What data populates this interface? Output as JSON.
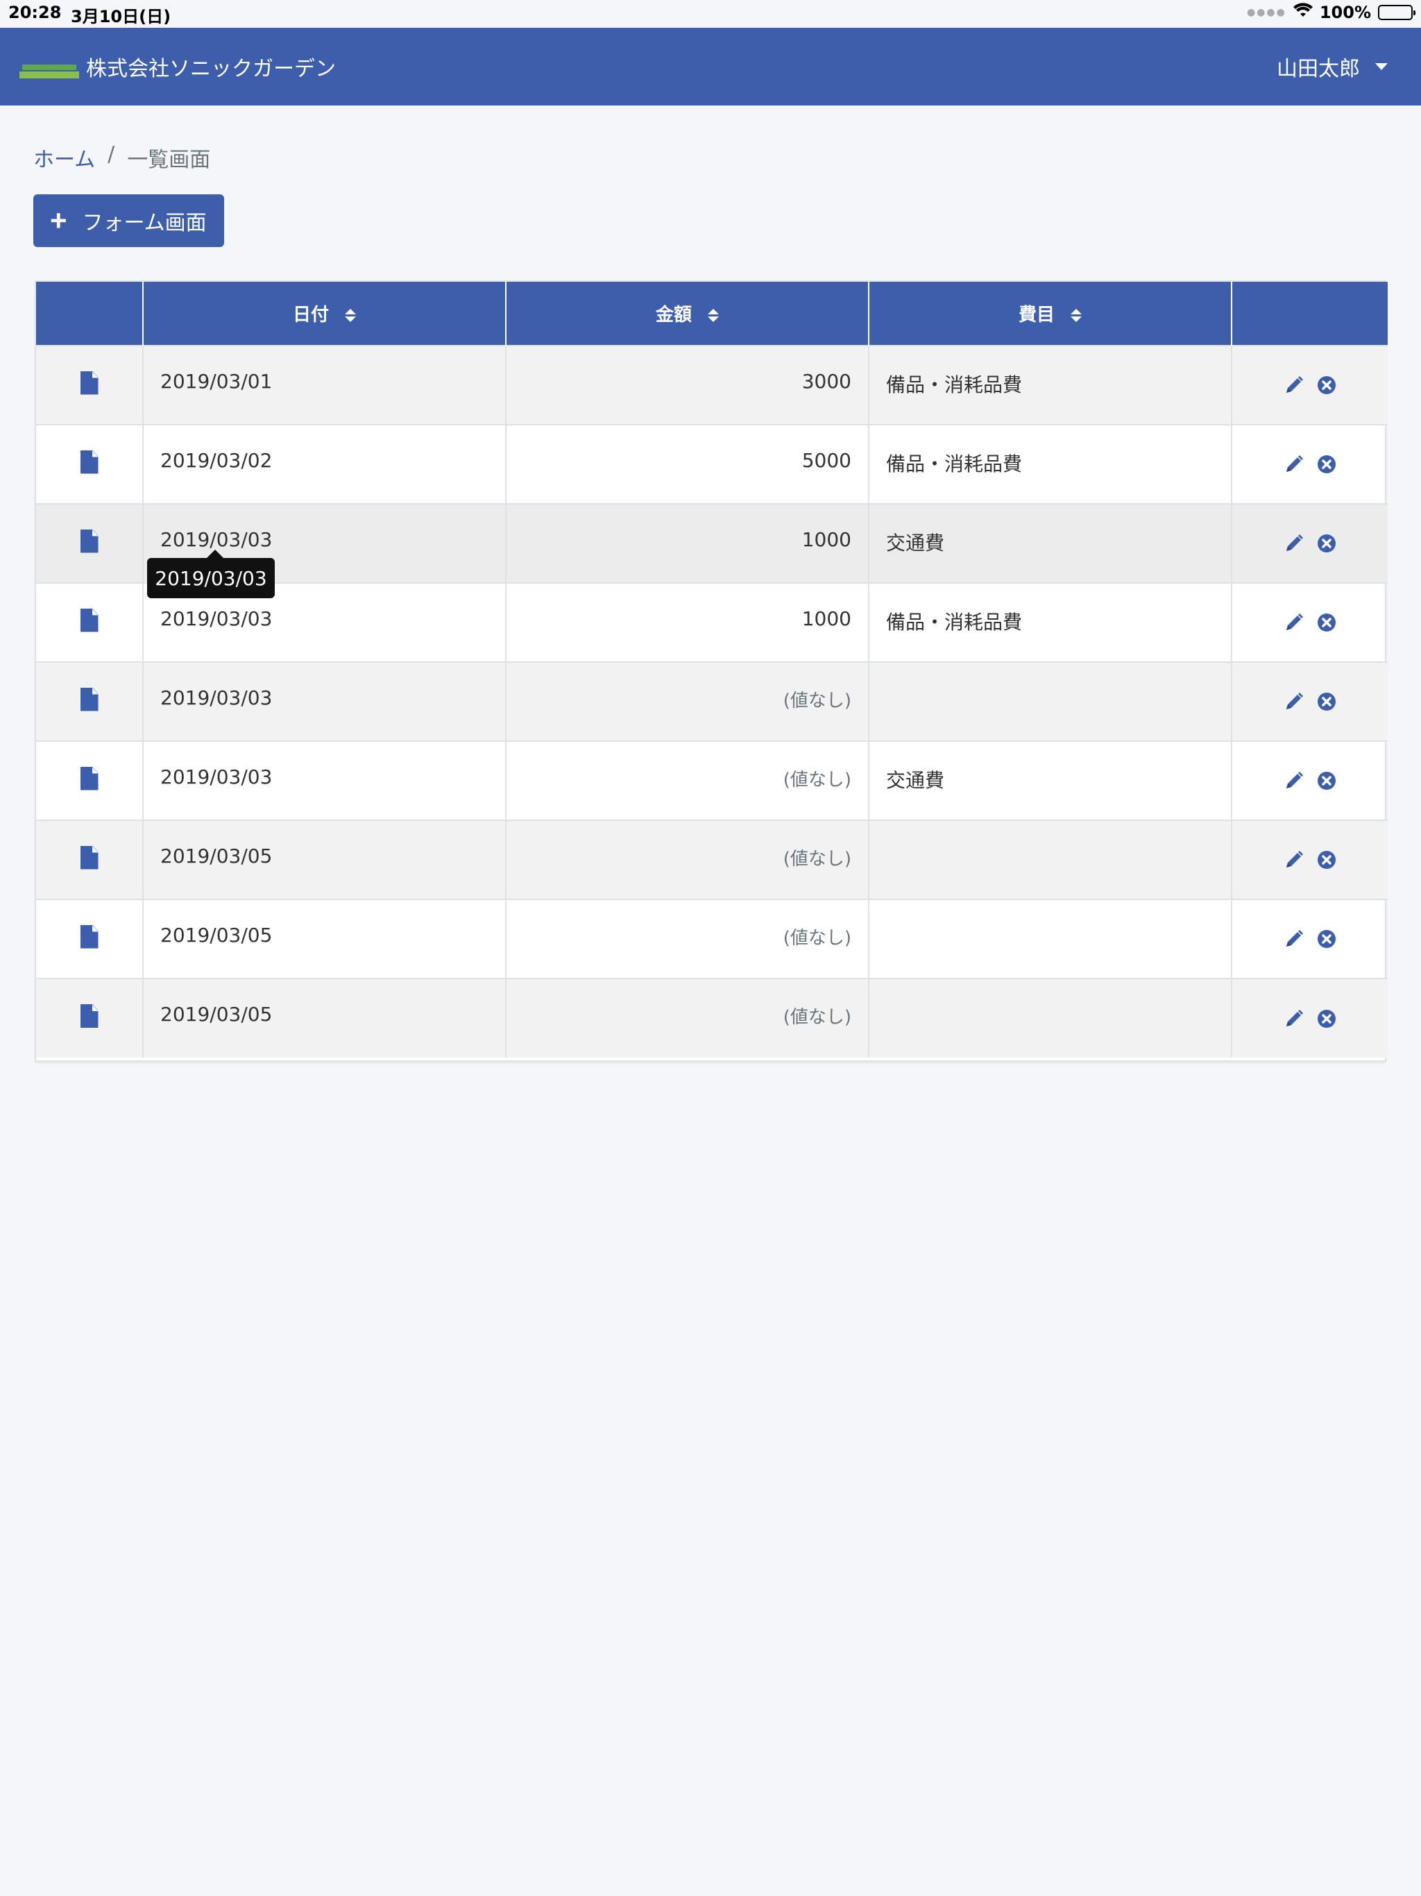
{
  "status_bar": {
    "time": "20:28",
    "date": "3月10日(日)",
    "battery": "100%"
  },
  "navbar": {
    "brand": "株式会社ソニックガーデン",
    "user": "山田太郎"
  },
  "breadcrumb": {
    "home": "ホーム",
    "separator": "/",
    "current": "一覧画面"
  },
  "add_button": {
    "label": "フォーム画面"
  },
  "table": {
    "headers": {
      "date": "日付",
      "amount": "金額",
      "category": "費目"
    },
    "rows": [
      {
        "date": "2019/03/01",
        "amount": "3000",
        "category": "備品・消耗品費"
      },
      {
        "date": "2019/03/02",
        "amount": "5000",
        "category": "備品・消耗品費"
      },
      {
        "date": "2019/03/03",
        "amount": "1000",
        "category": "交通費"
      },
      {
        "date": "2019/03/03",
        "amount": "1000",
        "category": "備品・消耗品費"
      },
      {
        "date": "2019/03/03",
        "amount": "(値なし)",
        "category": ""
      },
      {
        "date": "2019/03/03",
        "amount": "(値なし)",
        "category": "交通費"
      },
      {
        "date": "2019/03/05",
        "amount": "(値なし)",
        "category": ""
      },
      {
        "date": "2019/03/05",
        "amount": "(値なし)",
        "category": ""
      },
      {
        "date": "2019/03/05",
        "amount": "(値なし)",
        "category": ""
      }
    ]
  },
  "tooltip": {
    "text": "2019/03/03"
  },
  "colors": {
    "primary": "#3d5fab",
    "background": "#f5f6fa"
  }
}
